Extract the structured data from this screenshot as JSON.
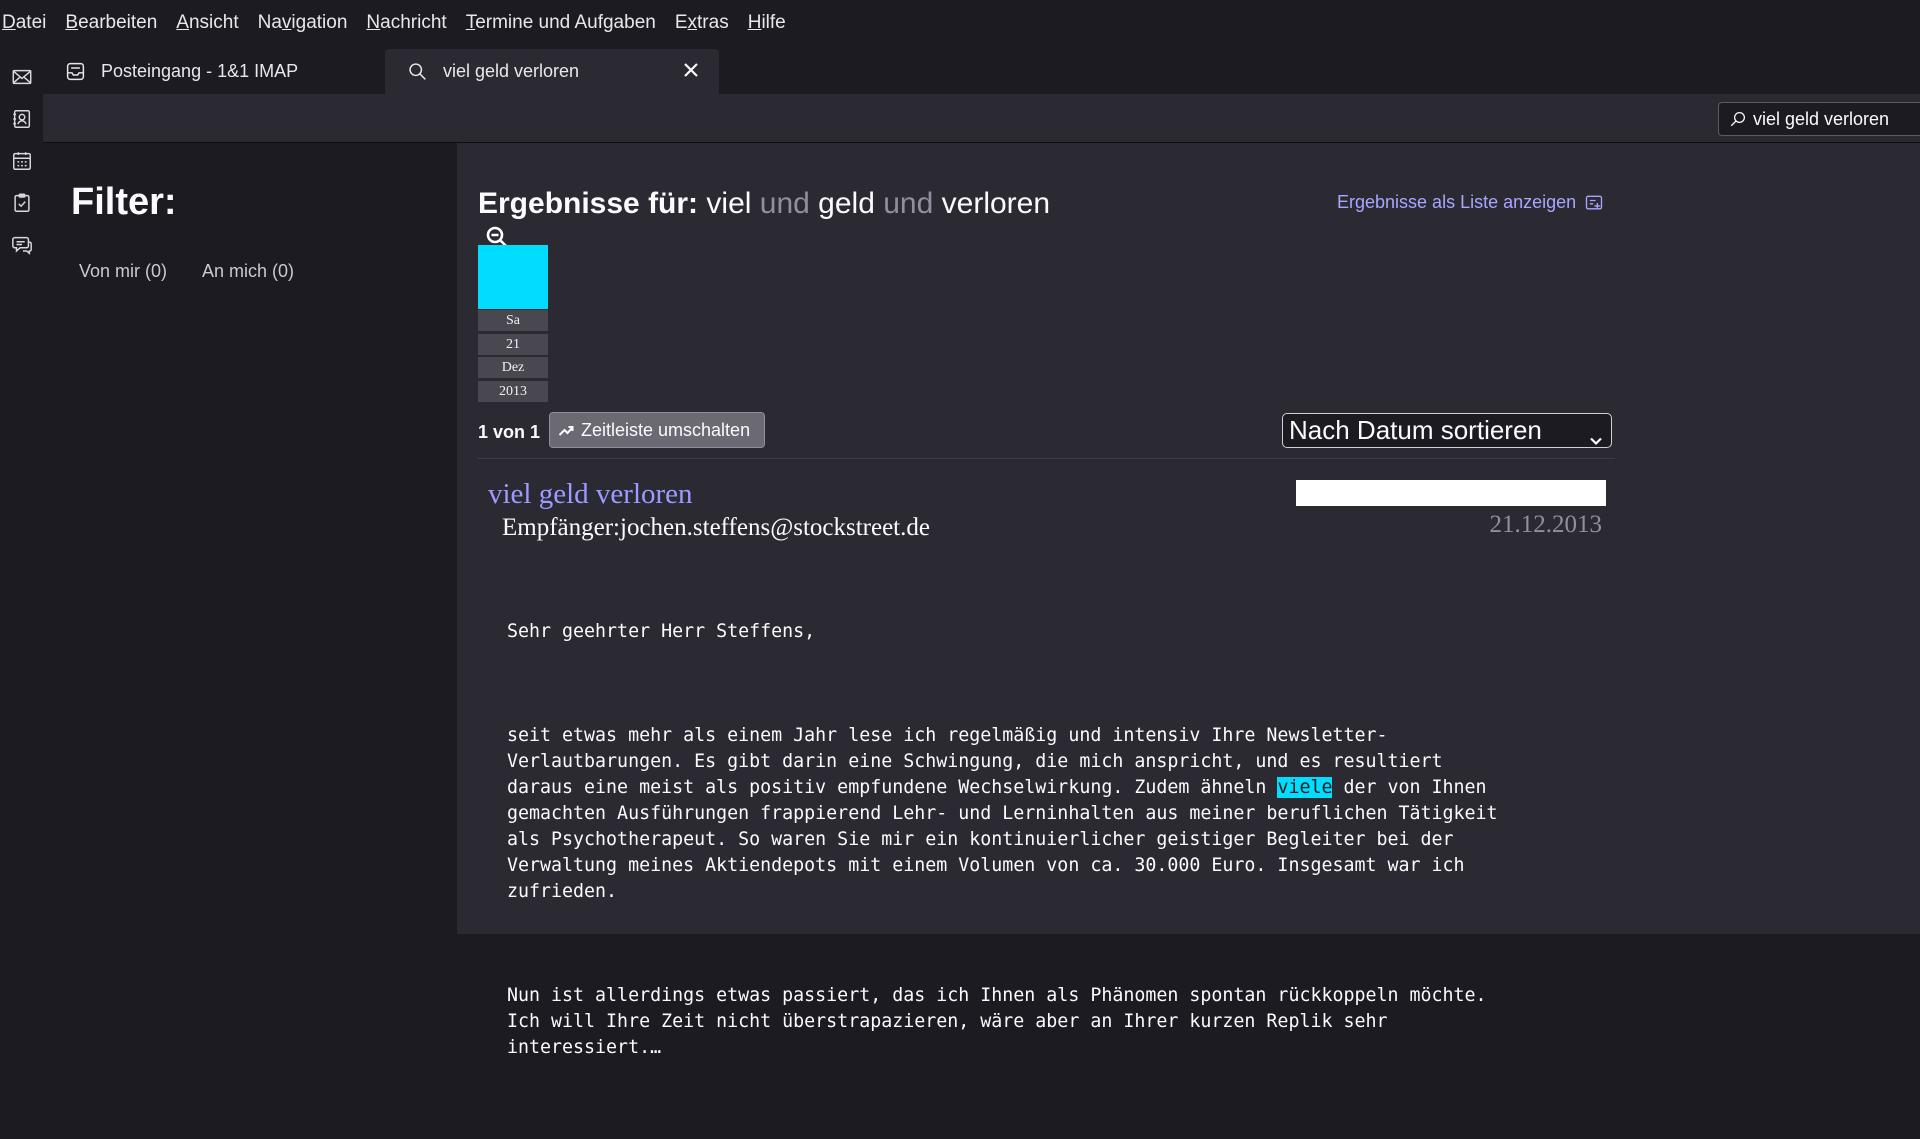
{
  "menubar": {
    "items": [
      {
        "mnemonic": "D",
        "rest": "atei"
      },
      {
        "mnemonic": "B",
        "rest": "earbeiten"
      },
      {
        "mnemonic": "A",
        "rest": "nsicht"
      },
      {
        "pre": "Na",
        "mnemonic": "v",
        "rest": "igation"
      },
      {
        "mnemonic": "N",
        "rest": "achricht"
      },
      {
        "mnemonic": "T",
        "rest": "ermine und Aufgaben"
      },
      {
        "pre": "E",
        "mnemonic": "x",
        "rest": "tras"
      },
      {
        "mnemonic": "H",
        "rest": "ilfe"
      }
    ]
  },
  "spaces": {
    "icons": [
      "mail-icon",
      "address-book-icon",
      "calendar-icon",
      "tasks-icon",
      "chat-icon"
    ]
  },
  "tabs": {
    "inbox": {
      "label": "Posteingang - 1&1 IMAP",
      "icon": "inbox-icon"
    },
    "search": {
      "label": "viel geld verloren",
      "icon": "search-icon",
      "close_icon": "close-icon"
    }
  },
  "toolbar": {
    "quick_search_value": "viel geld verloren"
  },
  "filter": {
    "title": "Filter:",
    "von_mir": "Von mir  (0)",
    "an_mich": "An mich  (0)"
  },
  "results": {
    "heading_label": "Ergebnisse für:",
    "terms": [
      "viel",
      "geld",
      "verloren"
    ],
    "conjunction": "und",
    "list_link": "Ergebnisse als Liste anzeigen",
    "timeline": {
      "day": "Sa",
      "date": "21",
      "month": "Dez",
      "year": "2013"
    },
    "count": "1 von 1",
    "timeline_toggle": "Zeitleiste umschalten",
    "sort_label": "Nach Datum sortieren",
    "item": {
      "subject": "viel geld verloren",
      "recipient": "Empfänger:jochen.steffens@stockstreet.de",
      "date": "21.12.2013",
      "greeting": "Sehr geehrter Herr Steffens,",
      "para1_a": "seit etwas mehr als einem Jahr lese ich regelmäßig und intensiv Ihre Newsletter-\nVerlautbarungen. Es gibt darin eine Schwingung, die mich anspricht, und es resultiert\ndaraus eine meist als positiv empfundene Wechselwirkung. Zudem ähneln ",
      "highlight": "viele",
      "para1_b": " der von Ihnen\ngemachten Ausführungen frappierend Lehr- und Lerninhalten aus meiner beruflichen Tätigkeit\nals Psychotherapeut. So waren Sie mir ein kontinuierlicher geistiger Begleiter bei der\nVerwaltung meines Aktiendepots mit einem Volumen von ca. 30.000 Euro. Insgesamt war ich\nzufrieden.",
      "para2": "Nun ist allerdings etwas passiert, das ich Ihnen als Phänomen spontan rückkoppeln möchte.\nIch will Ihre Zeit nicht überstrapazieren, wäre aber an Ihrer kurzen Replik sehr\ninteressiert.…"
    }
  },
  "colors": {
    "accent_link": "#a8a6ff",
    "highlight": "#00ddff"
  }
}
